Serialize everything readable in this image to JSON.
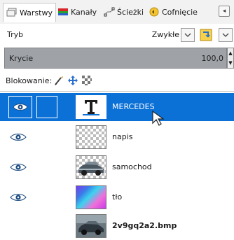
{
  "tabs": [
    {
      "label": "Warstwy",
      "icon": "layers-icon",
      "active": true
    },
    {
      "label": "Kanały",
      "icon": "channels-icon",
      "active": false
    },
    {
      "label": "Ścieżki",
      "icon": "paths-icon",
      "active": false
    },
    {
      "label": "Cofnięcie",
      "icon": "undo-history-icon",
      "active": false
    }
  ],
  "tab_menu_icon": "tab-menu-icon",
  "mode": {
    "label": "Tryb",
    "value": "Zwykłe"
  },
  "opacity": {
    "label": "Krycie",
    "value": "100,0"
  },
  "lock": {
    "label": "Blokowanie:",
    "icons": [
      "lock-pixels-icon",
      "lock-position-icon",
      "lock-alpha-icon"
    ]
  },
  "layers": [
    {
      "name": "MERCEDES",
      "selected": true,
      "visible": true,
      "type": "text",
      "bold": false
    },
    {
      "name": "napis",
      "selected": false,
      "visible": true,
      "type": "transparent",
      "bold": false
    },
    {
      "name": "samochod",
      "selected": false,
      "visible": true,
      "type": "car",
      "bold": false
    },
    {
      "name": "tło",
      "selected": false,
      "visible": true,
      "type": "gradient",
      "bold": false
    },
    {
      "name": "2v9gq2a2.bmp",
      "selected": false,
      "visible": false,
      "type": "photo",
      "bold": true
    }
  ],
  "colors": {
    "selection": "#0c71d6",
    "opacity_bar": "#9fa3a8"
  }
}
